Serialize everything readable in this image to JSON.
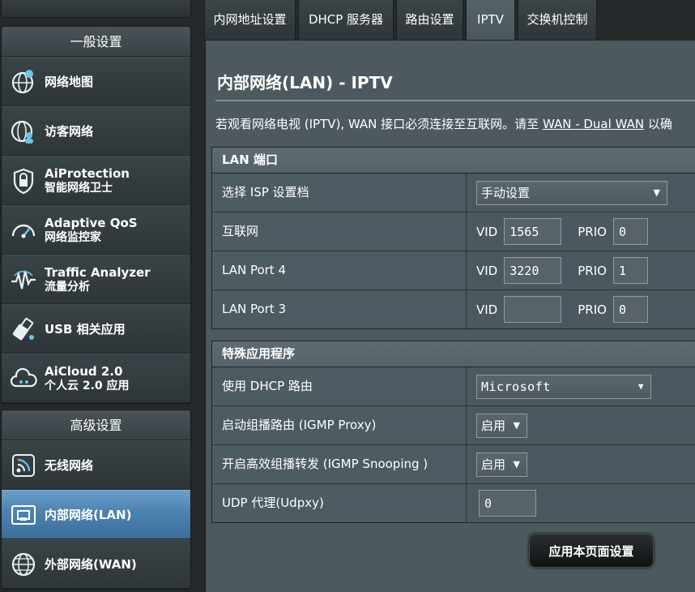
{
  "sidebar": {
    "general_title": "一般设置",
    "advanced_title": "高级设置",
    "general_items": [
      {
        "l1": "网络地图",
        "l2": "",
        "icon": "network-map-icon"
      },
      {
        "l1": "访客网络",
        "l2": "",
        "icon": "guest-network-icon"
      },
      {
        "l1": "AiProtection",
        "l2": "智能网络卫士",
        "icon": "aiprotection-shield-icon"
      },
      {
        "l1": "Adaptive QoS",
        "l2": "网络监控家",
        "icon": "qos-gauge-icon"
      },
      {
        "l1": "Traffic Analyzer",
        "l2": "流量分析",
        "icon": "traffic-analyzer-icon"
      },
      {
        "l1": "USB 相关应用",
        "l2": "",
        "icon": "usb-icon"
      },
      {
        "l1": "AiCloud 2.0",
        "l2": "个人云 2.0 应用",
        "icon": "cloud-icon"
      }
    ],
    "advanced_items": [
      {
        "l1": "无线网络",
        "l2": "",
        "icon": "wireless-icon"
      },
      {
        "l1": "内部网络(LAN)",
        "l2": "",
        "icon": "lan-icon",
        "active": true
      },
      {
        "l1": "外部网络(WAN)",
        "l2": "",
        "icon": "wan-globe-icon"
      }
    ]
  },
  "tabs": [
    "内网地址设置",
    "DHCP 服务器",
    "路由设置",
    "IPTV",
    "交换机控制"
  ],
  "active_tab": "IPTV",
  "page": {
    "title": "内部网络(LAN) - IPTV",
    "desc_prefix": "若观看网络电视 (IPTV), WAN 接口必须连接至互联网。请至 ",
    "desc_link": "WAN - Dual WAN",
    "desc_suffix": " 以确"
  },
  "lan_port": {
    "header": "LAN 端口",
    "isp_label": "选择 ISP 设置档",
    "isp_value": "手动设置",
    "vid_label": "VID",
    "prio_label": "PRIO",
    "rows": [
      {
        "label": "互联网",
        "vid": "1565",
        "prio": "0"
      },
      {
        "label": "LAN Port 4",
        "vid": "3220",
        "prio": "1"
      },
      {
        "label": "LAN Port 3",
        "vid": "",
        "prio": "0"
      }
    ]
  },
  "special": {
    "header": "特殊应用程序",
    "dhcp_label": "使用 DHCP 路由",
    "dhcp_value": "Microsoft",
    "igmp_proxy_label": "启动组播路由 (IGMP Proxy)",
    "igmp_proxy_value": "启用",
    "igmp_snoop_label": "开启高效组播转发 (IGMP Snooping )",
    "igmp_snoop_value": "启用",
    "udpxy_label": "UDP 代理(Udpxy)",
    "udpxy_value": "0"
  },
  "apply_label": "应用本页面设置",
  "colors": {
    "accent_active": "#4d82b0",
    "panel_bg": "#4d595f",
    "page_bg": "#25292b"
  }
}
